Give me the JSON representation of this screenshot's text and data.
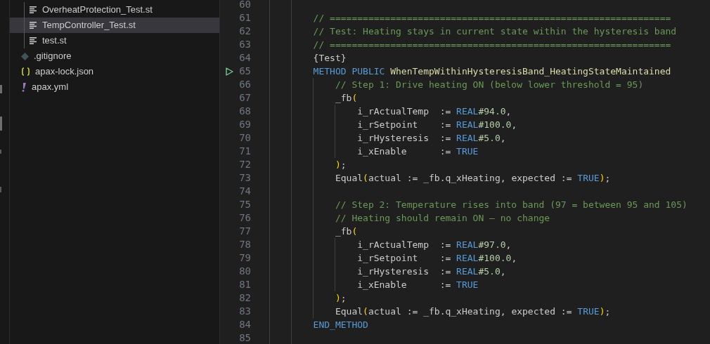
{
  "explorer": {
    "nested_items": [
      {
        "name": "OverheatProtection_Test.st",
        "kind": "st",
        "selected": false
      },
      {
        "name": "TempController_Test.st",
        "kind": "st",
        "selected": true
      },
      {
        "name": "test.st",
        "kind": "st",
        "selected": false
      }
    ],
    "items": [
      {
        "name": ".gitignore",
        "kind": "gitignore",
        "selected": false
      },
      {
        "name": "apax-lock.json",
        "kind": "json",
        "selected": false
      },
      {
        "name": "apax.yml",
        "kind": "yml",
        "selected": false
      }
    ]
  },
  "editor": {
    "lines": [
      {
        "number": "60",
        "runnable": false
      },
      {
        "number": "61",
        "runnable": false,
        "tokens": [
          {
            "kind": "comment",
            "text": "        // =============================================================="
          }
        ]
      },
      {
        "number": "62",
        "runnable": false,
        "tokens": [
          {
            "kind": "comment",
            "text": "        // Test: Heating stays in current state within the hysteresis band"
          }
        ]
      },
      {
        "number": "63",
        "runnable": false,
        "tokens": [
          {
            "kind": "comment",
            "text": "        // =============================================================="
          }
        ]
      },
      {
        "number": "64",
        "runnable": false,
        "tokens": [
          {
            "kind": "plain",
            "text": "        {Test}"
          }
        ]
      },
      {
        "number": "65",
        "runnable": true,
        "tokens": [
          {
            "kind": "keyword",
            "text": "        METHOD PUBLIC "
          },
          {
            "kind": "function",
            "text": "WhenTempWithinHysteresisBand_HeatingStateMaintained"
          }
        ]
      },
      {
        "number": "66",
        "runnable": false,
        "tokens": [
          {
            "kind": "comment",
            "text": "            // Step 1: Drive heating ON (below lower threshold = 95)"
          }
        ]
      },
      {
        "number": "67",
        "runnable": false,
        "tokens": [
          {
            "kind": "plain",
            "text": "            _fb"
          },
          {
            "kind": "bracket",
            "text": "("
          }
        ]
      },
      {
        "number": "68",
        "runnable": false,
        "tokens": [
          {
            "kind": "plain",
            "text": "                i_rActualTemp  := "
          },
          {
            "kind": "keyword",
            "text": "REAL"
          },
          {
            "kind": "number",
            "text": "#94.0"
          },
          {
            "kind": "plain",
            "text": ","
          }
        ]
      },
      {
        "number": "69",
        "runnable": false,
        "tokens": [
          {
            "kind": "plain",
            "text": "                i_rSetpoint    := "
          },
          {
            "kind": "keyword",
            "text": "REAL"
          },
          {
            "kind": "number",
            "text": "#100.0"
          },
          {
            "kind": "plain",
            "text": ","
          }
        ]
      },
      {
        "number": "70",
        "runnable": false,
        "tokens": [
          {
            "kind": "plain",
            "text": "                i_rHysteresis  := "
          },
          {
            "kind": "keyword",
            "text": "REAL"
          },
          {
            "kind": "number",
            "text": "#5.0"
          },
          {
            "kind": "plain",
            "text": ","
          }
        ]
      },
      {
        "number": "71",
        "runnable": false,
        "tokens": [
          {
            "kind": "plain",
            "text": "                i_xEnable      := "
          },
          {
            "kind": "keyword",
            "text": "TRUE"
          }
        ]
      },
      {
        "number": "72",
        "runnable": false,
        "tokens": [
          {
            "kind": "bracket",
            "text": "            )"
          },
          {
            "kind": "plain",
            "text": ";"
          }
        ]
      },
      {
        "number": "73",
        "runnable": false,
        "tokens": [
          {
            "kind": "plain",
            "text": "            Equal"
          },
          {
            "kind": "bracket",
            "text": "("
          },
          {
            "kind": "plain",
            "text": "actual := _fb.q_xHeating, expected := "
          },
          {
            "kind": "keyword",
            "text": "TRUE"
          },
          {
            "kind": "bracket",
            "text": ")"
          },
          {
            "kind": "plain",
            "text": ";"
          }
        ]
      },
      {
        "number": "74",
        "runnable": false
      },
      {
        "number": "75",
        "runnable": false,
        "tokens": [
          {
            "kind": "comment",
            "text": "            // Step 2: Temperature rises into band (97 = between 95 and 105)"
          }
        ]
      },
      {
        "number": "76",
        "runnable": false,
        "tokens": [
          {
            "kind": "comment",
            "text": "            // Heating should remain ON — no change"
          }
        ]
      },
      {
        "number": "77",
        "runnable": false,
        "tokens": [
          {
            "kind": "plain",
            "text": "            _fb"
          },
          {
            "kind": "bracket",
            "text": "("
          }
        ]
      },
      {
        "number": "78",
        "runnable": false,
        "tokens": [
          {
            "kind": "plain",
            "text": "                i_rActualTemp  := "
          },
          {
            "kind": "keyword",
            "text": "REAL"
          },
          {
            "kind": "number",
            "text": "#97.0"
          },
          {
            "kind": "plain",
            "text": ","
          }
        ]
      },
      {
        "number": "79",
        "runnable": false,
        "tokens": [
          {
            "kind": "plain",
            "text": "                i_rSetpoint    := "
          },
          {
            "kind": "keyword",
            "text": "REAL"
          },
          {
            "kind": "number",
            "text": "#100.0"
          },
          {
            "kind": "plain",
            "text": ","
          }
        ]
      },
      {
        "number": "80",
        "runnable": false,
        "tokens": [
          {
            "kind": "plain",
            "text": "                i_rHysteresis  := "
          },
          {
            "kind": "keyword",
            "text": "REAL"
          },
          {
            "kind": "number",
            "text": "#5.0"
          },
          {
            "kind": "plain",
            "text": ","
          }
        ]
      },
      {
        "number": "81",
        "runnable": false,
        "tokens": [
          {
            "kind": "plain",
            "text": "                i_xEnable      := "
          },
          {
            "kind": "keyword",
            "text": "TRUE"
          }
        ]
      },
      {
        "number": "82",
        "runnable": false,
        "tokens": [
          {
            "kind": "bracket",
            "text": "            )"
          },
          {
            "kind": "plain",
            "text": ";"
          }
        ]
      },
      {
        "number": "83",
        "runnable": false,
        "tokens": [
          {
            "kind": "plain",
            "text": "            Equal"
          },
          {
            "kind": "bracket",
            "text": "("
          },
          {
            "kind": "plain",
            "text": "actual := _fb.q_xHeating, expected := "
          },
          {
            "kind": "keyword",
            "text": "TRUE"
          },
          {
            "kind": "bracket",
            "text": ")"
          },
          {
            "kind": "plain",
            "text": ";"
          }
        ]
      },
      {
        "number": "84",
        "runnable": false,
        "tokens": [
          {
            "kind": "keyword",
            "text": "        END_METHOD"
          }
        ]
      },
      {
        "number": "85",
        "runnable": false
      }
    ]
  }
}
